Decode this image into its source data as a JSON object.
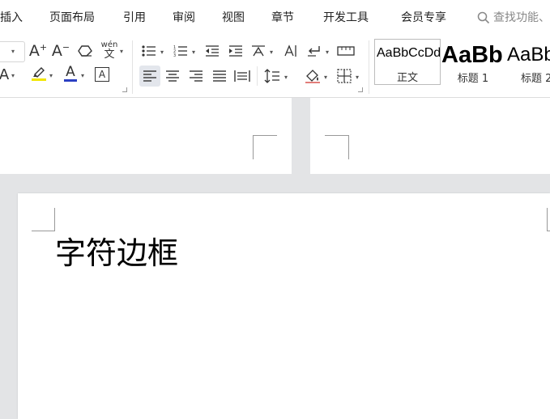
{
  "menu": {
    "items": [
      "插入",
      "页面布局",
      "引用",
      "审阅",
      "视图",
      "章节",
      "开发工具",
      "会员专享"
    ],
    "search_placeholder": "查找功能、"
  },
  "toolbar": {
    "font_icons": {
      "grow_font": "A⁺",
      "shrink_font": "A⁻",
      "pinyin": "wén"
    },
    "styles": [
      {
        "sample": "AaBbCcDd",
        "name": "正文"
      },
      {
        "sample": "AaBb",
        "name": "标题 1"
      },
      {
        "sample": "AaBb",
        "name": "标题 2"
      }
    ]
  },
  "document": {
    "body_text": "字符边框"
  },
  "colors": {
    "highlight": "#f2e600",
    "font_color": "#2b3fc2",
    "active_bg": "#e3e6ec",
    "canvas_bg": "#e3e4e6"
  }
}
